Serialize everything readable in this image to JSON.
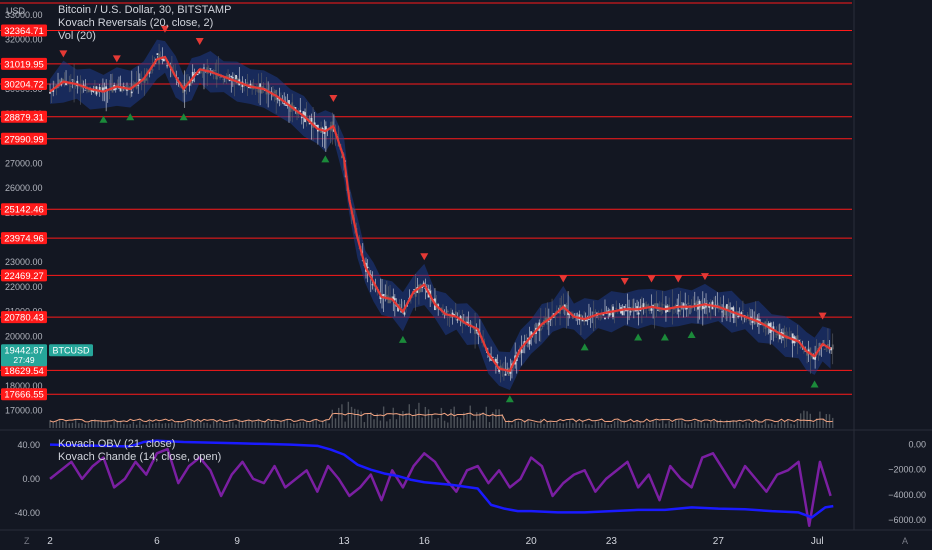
{
  "legend": {
    "title": "Bitcoin / U.S. Dollar, 30, BITSTAMP",
    "indicator1": "Kovach Reversals (20, close, 2)",
    "indicator2": "Vol (20)"
  },
  "sublegend": {
    "indicator1": "Kovach OBV (21, close)",
    "indicator2": "Kovach Chande (14, close, open)"
  },
  "axis": {
    "unit": "USD"
  },
  "corners": {
    "bottom_left": "Z",
    "bottom_right": "A"
  },
  "colors": {
    "background": "#131722",
    "level_line": "#ff1a1a",
    "level_badge": "#ff1a1a",
    "price_badge": "#26a69a",
    "candle_up": "#b2b5be",
    "ma_line": "#e53935",
    "band": "#1e3a8a",
    "up_marker": "#1b8a3a",
    "down_marker": "#e53935",
    "obv_line": "#1a1aff",
    "chande_line": "#7b1fa2",
    "volume_line": "#f4a582"
  },
  "chart_data": [
    {
      "type": "line",
      "title": "Bitcoin / U.S. Dollar, 30, BITSTAMP",
      "y_ticks": [
        33000,
        32000,
        31000,
        30000,
        29000,
        28000,
        27000,
        26000,
        25000,
        24000,
        23000,
        22000,
        21000,
        20000,
        19000,
        18000,
        17000
      ],
      "y_tick_labels": [
        "33000.00",
        "32000.00",
        "31000.00",
        "30000.00",
        "29000.00",
        "28000.00",
        "27000.00",
        "26000.00",
        "25000.00",
        "24000.00",
        "23000.00",
        "22000.00",
        "21000.00",
        "20000.00",
        "19000.00",
        "18000.00",
        "17000.00"
      ],
      "ylim": [
        16300,
        33600
      ],
      "x_ticks": [
        2,
        6,
        9,
        13,
        16,
        20,
        23,
        27,
        30.7
      ],
      "x_tick_labels": [
        "2",
        "6",
        "9",
        "13",
        "16",
        "20",
        "23",
        "27",
        "Jul"
      ],
      "xlim": [
        2,
        32
      ],
      "levels": [
        {
          "value": 32364.71,
          "label": "32364.71"
        },
        {
          "value": 31019.95,
          "label": "31019.95"
        },
        {
          "value": 30204.72,
          "label": "30204.72"
        },
        {
          "value": 28879.31,
          "label": "28879.31"
        },
        {
          "value": 27990.99,
          "label": "27990.99"
        },
        {
          "value": 25142.46,
          "label": "25142.46"
        },
        {
          "value": 23974.96,
          "label": "23974.96"
        },
        {
          "value": 22469.27,
          "label": "22469.27"
        },
        {
          "value": 20780.43,
          "label": "20780.43"
        },
        {
          "value": 18629.54,
          "label": "18629.54"
        },
        {
          "value": 17666.55,
          "label": "17666.55"
        }
      ],
      "current_price": {
        "value": 19442.87,
        "label": "19442.87",
        "symbol": "BTCUSD",
        "countdown": "27:49"
      },
      "series": [
        {
          "name": "Kovach Reversals (20, close, 2)",
          "x": [
            2,
            2.5,
            3,
            3.5,
            4,
            4.5,
            5,
            5.5,
            6,
            6.3,
            6.7,
            7,
            7.3,
            7.6,
            8,
            8.5,
            9,
            9.5,
            10,
            10.5,
            11,
            11.5,
            12,
            12.3,
            12.6,
            13,
            13.2,
            13.5,
            13.8,
            14.1,
            14.4,
            14.8,
            15.2,
            15.6,
            16,
            16.4,
            16.8,
            17.2,
            17.6,
            18,
            18.4,
            18.8,
            19.2,
            19.6,
            20,
            20.4,
            20.8,
            21.2,
            21.6,
            22,
            22.5,
            23,
            23.5,
            24,
            24.5,
            25,
            25.5,
            26,
            26.5,
            27,
            27.5,
            28,
            28.5,
            29,
            29.5,
            30,
            30.3,
            30.6,
            30.9,
            31.2
          ],
          "values": [
            29900,
            30300,
            30200,
            30000,
            29900,
            30100,
            30000,
            30400,
            31200,
            31300,
            30500,
            30000,
            30400,
            30800,
            30700,
            30500,
            30300,
            30100,
            30000,
            29700,
            29300,
            28900,
            28400,
            28300,
            28500,
            27200,
            25500,
            24000,
            22800,
            22200,
            21600,
            21500,
            21000,
            21800,
            22100,
            21300,
            20900,
            20800,
            20500,
            20300,
            19300,
            18700,
            18600,
            19500,
            20000,
            20500,
            20800,
            21200,
            20800,
            20700,
            20900,
            21000,
            21100,
            21100,
            21200,
            21100,
            21200,
            21200,
            21300,
            21200,
            21000,
            20800,
            20600,
            20300,
            20000,
            19800,
            19400,
            19200,
            19700,
            19500
          ]
        }
      ]
    },
    {
      "type": "line",
      "title": "Kovach OBV (21, close) / Kovach Chande (14, close, open)",
      "y_ticks_left": [
        40,
        0,
        -40
      ],
      "y_tick_labels_left": [
        "40.00",
        "0.00",
        "-40.00"
      ],
      "ylim_left": [
        -60,
        55
      ],
      "y_ticks_right": [
        0,
        -2000,
        -4000,
        -6000
      ],
      "y_tick_labels_right": [
        "0.00",
        "−2000.00",
        "−4000.00",
        "−6000.00"
      ],
      "ylim_right": [
        -6800,
        1000
      ],
      "series": [
        {
          "name": "Kovach OBV (21, close)",
          "x": [
            2,
            3,
            4,
            5,
            5.5,
            6,
            7,
            8,
            9,
            10,
            11,
            12,
            12.5,
            13,
            13.5,
            14,
            14.5,
            15,
            15.5,
            16,
            17,
            18,
            18.5,
            19,
            19.5,
            20,
            21,
            22,
            23,
            24,
            25,
            26,
            27,
            28,
            29,
            30,
            30.5,
            31,
            31.3
          ],
          "values": [
            0,
            -50,
            -100,
            -150,
            200,
            300,
            200,
            150,
            100,
            50,
            0,
            -100,
            -400,
            -800,
            -1600,
            -2000,
            -2300,
            -2500,
            -2800,
            -3000,
            -3200,
            -3500,
            -4800,
            -5100,
            -5300,
            -5300,
            -5400,
            -5400,
            -5300,
            -5200,
            -5200,
            -5000,
            -5100,
            -5150,
            -5300,
            -5400,
            -5800,
            -5000,
            -4900
          ]
        },
        {
          "name": "Kovach Chande (14, close, open)",
          "x": [
            2,
            2.4,
            2.8,
            3.2,
            3.6,
            4,
            4.4,
            4.8,
            5.2,
            5.6,
            6,
            6.4,
            6.8,
            7.2,
            7.6,
            8,
            8.4,
            8.8,
            9.2,
            9.6,
            10,
            10.4,
            10.8,
            11.2,
            11.6,
            12,
            12.4,
            12.8,
            13.2,
            13.6,
            14,
            14.4,
            14.8,
            15.2,
            15.6,
            16,
            16.4,
            16.8,
            17.2,
            17.6,
            18,
            18.4,
            18.8,
            19.2,
            19.6,
            20,
            20.4,
            20.8,
            21.2,
            21.6,
            22,
            22.4,
            22.8,
            23.2,
            23.6,
            24,
            24.4,
            24.8,
            25.2,
            25.6,
            26,
            26.4,
            26.8,
            27.2,
            27.6,
            28,
            28.4,
            28.8,
            29.2,
            29.6,
            30,
            30.4,
            30.8,
            31.2
          ],
          "values": [
            0,
            10,
            20,
            0,
            15,
            25,
            -10,
            0,
            20,
            5,
            30,
            35,
            -5,
            15,
            25,
            10,
            -20,
            5,
            20,
            0,
            -5,
            15,
            -10,
            0,
            10,
            -15,
            15,
            0,
            -20,
            -10,
            5,
            -25,
            10,
            -10,
            15,
            30,
            20,
            0,
            -15,
            10,
            15,
            -5,
            10,
            -10,
            0,
            25,
            15,
            -20,
            -5,
            5,
            10,
            -15,
            0,
            10,
            20,
            -10,
            5,
            -25,
            15,
            0,
            -10,
            25,
            30,
            10,
            -10,
            15,
            0,
            -15,
            5,
            10,
            20,
            -55,
            20,
            -20
          ]
        }
      ]
    }
  ]
}
